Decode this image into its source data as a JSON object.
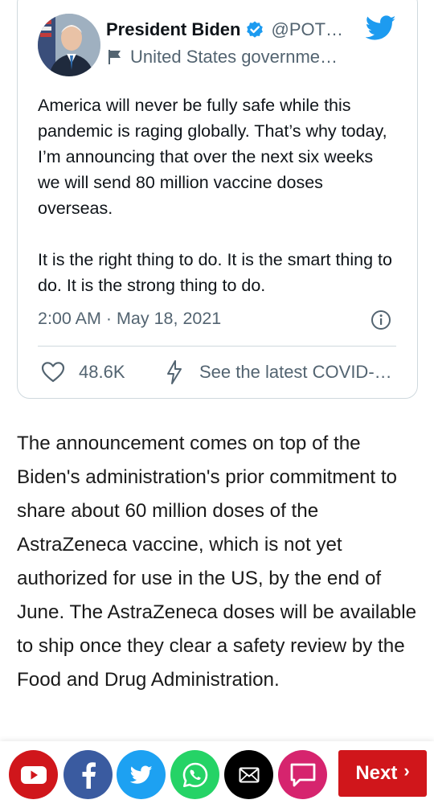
{
  "tweet": {
    "display_name": "President Biden",
    "handle": "@POT…",
    "account_label": "United States governme…",
    "paragraphs": [
      "America will never be fully safe while this pandemic is raging globally. That’s why today, I’m announcing that over the next six weeks we will send 80 million vaccine doses overseas.",
      "It is the right thing to do. It is the smart thing to do. It is the strong thing to do."
    ],
    "timestamp": "2:00 AM · May 18, 2021",
    "like_count": "48.6K",
    "covid_link": "See the latest COVID-…",
    "colors": {
      "verified": "#1d9bf0",
      "twitter_blue": "#1d9bf0",
      "muted": "#536471"
    }
  },
  "article": {
    "paragraph": "The announcement comes on top of the Biden's administration's prior commitment to share about 60 million doses of the AstraZeneca vaccine, which is not yet authorized for use in the US, by the end of June. The AstraZeneca doses will be available to ship once they clear a safety review by the Food and Drug Administration."
  },
  "share_bar": {
    "buttons": [
      {
        "name": "youtube",
        "icon": "youtube-icon",
        "color": "#d0161b"
      },
      {
        "name": "facebook",
        "icon": "facebook-icon",
        "color": "#3a5ba0"
      },
      {
        "name": "twitter",
        "icon": "twitter-icon",
        "color": "#1da1f2"
      },
      {
        "name": "whatsapp",
        "icon": "whatsapp-icon",
        "color": "#25d366"
      },
      {
        "name": "email",
        "icon": "email-icon",
        "color": "#000000"
      },
      {
        "name": "comment",
        "icon": "comment-icon",
        "color": "#d6246e"
      }
    ],
    "next_label": "Next",
    "next_color": "#d0161b"
  }
}
